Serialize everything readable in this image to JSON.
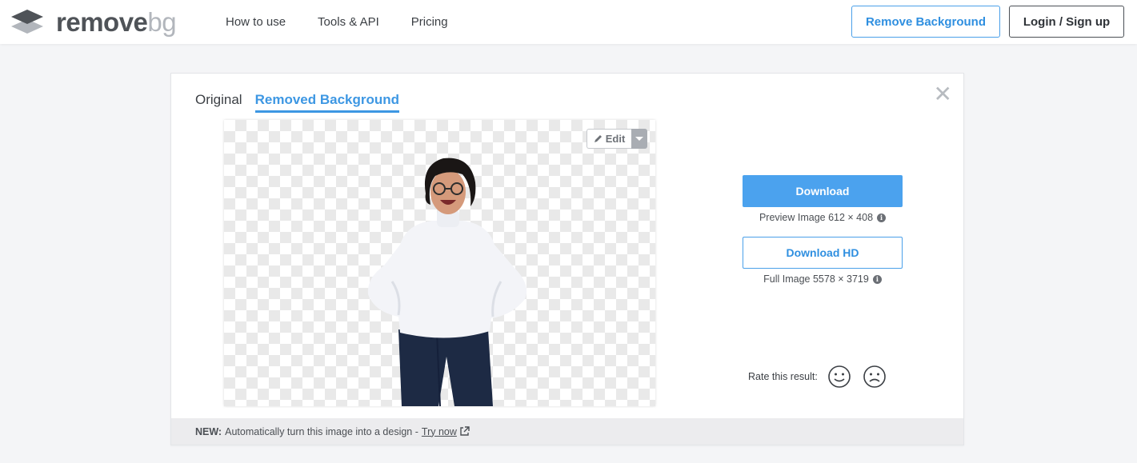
{
  "header": {
    "logo": {
      "word1": "remove",
      "word2": "bg",
      "icon": "layers-icon"
    },
    "nav": [
      "How to use",
      "Tools & API",
      "Pricing"
    ],
    "remove_background_label": "Remove Background",
    "login_label": "Login / Sign up"
  },
  "card": {
    "tabs": {
      "original": "Original",
      "removed": "Removed Background"
    },
    "close_glyph": "✕",
    "edit_label": "Edit",
    "download": {
      "label": "Download",
      "preview_info": "Preview Image 612 × 408"
    },
    "download_hd": {
      "label": "Download HD",
      "full_info": "Full Image 5578 × 3719"
    },
    "rate_label": "Rate this result:",
    "footer": {
      "new_label": "NEW:",
      "text": "Automatically turn this image into a design -",
      "link": "Try now"
    }
  },
  "colors": {
    "accent": "#3d97e3",
    "download_bg": "#4ba2ee"
  }
}
